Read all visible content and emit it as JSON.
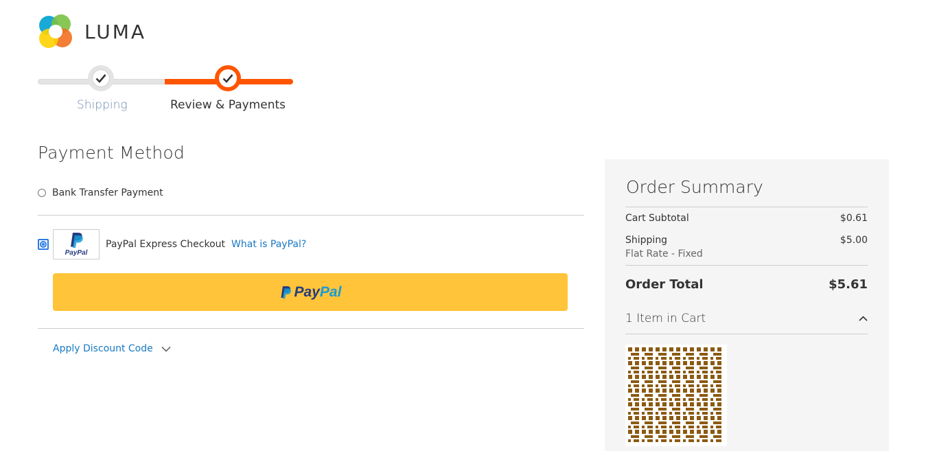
{
  "brand": {
    "name": "LUMA"
  },
  "progress": {
    "steps": [
      {
        "label": "Shipping",
        "state": "complete"
      },
      {
        "label": "Review & Payments",
        "state": "active"
      }
    ],
    "accent_color": "#ff5501"
  },
  "payment": {
    "title": "Payment Method",
    "methods": [
      {
        "label": "Bank Transfer Payment",
        "selected": false
      },
      {
        "label": "PayPal Express Checkout",
        "selected": true,
        "logo_text": "PayPal",
        "link": "What is PayPal?"
      }
    ],
    "paypal_button": {
      "pay": "Pay",
      "pal": "Pal",
      "color": "#ffc439"
    },
    "discount_label": "Apply Discount Code"
  },
  "summary": {
    "title": "Order Summary",
    "subtotal_label": "Cart Subtotal",
    "subtotal_value": "$0.61",
    "shipping_label": "Shipping",
    "shipping_value": "$5.00",
    "shipping_method": "Flat Rate - Fixed",
    "total_label": "Order Total",
    "total_value": "$5.61",
    "items_label": "1 Item in Cart"
  }
}
